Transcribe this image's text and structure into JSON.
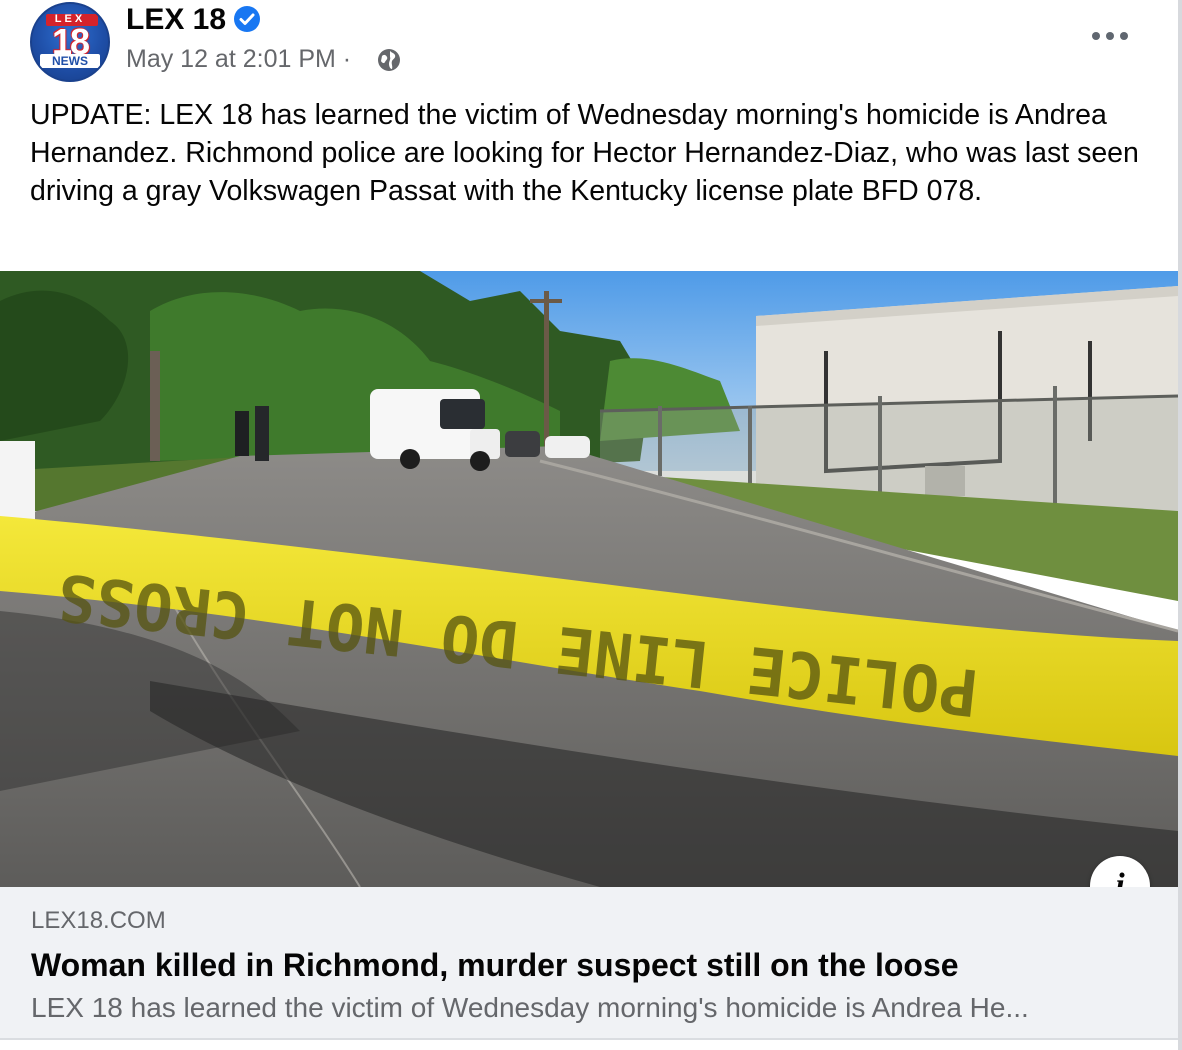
{
  "post": {
    "page_name": "LEX 18",
    "timestamp": "May 12 at 2:01 PM",
    "separator": "·",
    "privacy_icon": "globe-icon",
    "verified_icon": "verified-badge-icon",
    "more_icon": "more-options-icon",
    "avatar": {
      "logo_top": "LEX",
      "logo_number": "18",
      "logo_bottom": "NEWS"
    },
    "text": "UPDATE: LEX 18 has learned the victim of Wednesday morning's homicide is Andrea Hernandez. Richmond police are looking for Hector Hernandez-Diaz, who was last seen driving a gray Volkswagen Passat with the Kentucky license plate BFD 078."
  },
  "photo": {
    "tape_text": "POLICE LINE DO NOT CROSS",
    "info_label": "i"
  },
  "link_preview": {
    "domain": "LEX18.COM",
    "title": "Woman killed in Richmond, murder suspect still on the loose",
    "description": "LEX 18 has learned the victim of Wednesday morning's homicide is Andrea He..."
  },
  "colors": {
    "verified": "#1877f2",
    "secondary_text": "#65676b",
    "link_box_bg": "#f0f2f5",
    "tape_yellow": "#f2e21a"
  }
}
